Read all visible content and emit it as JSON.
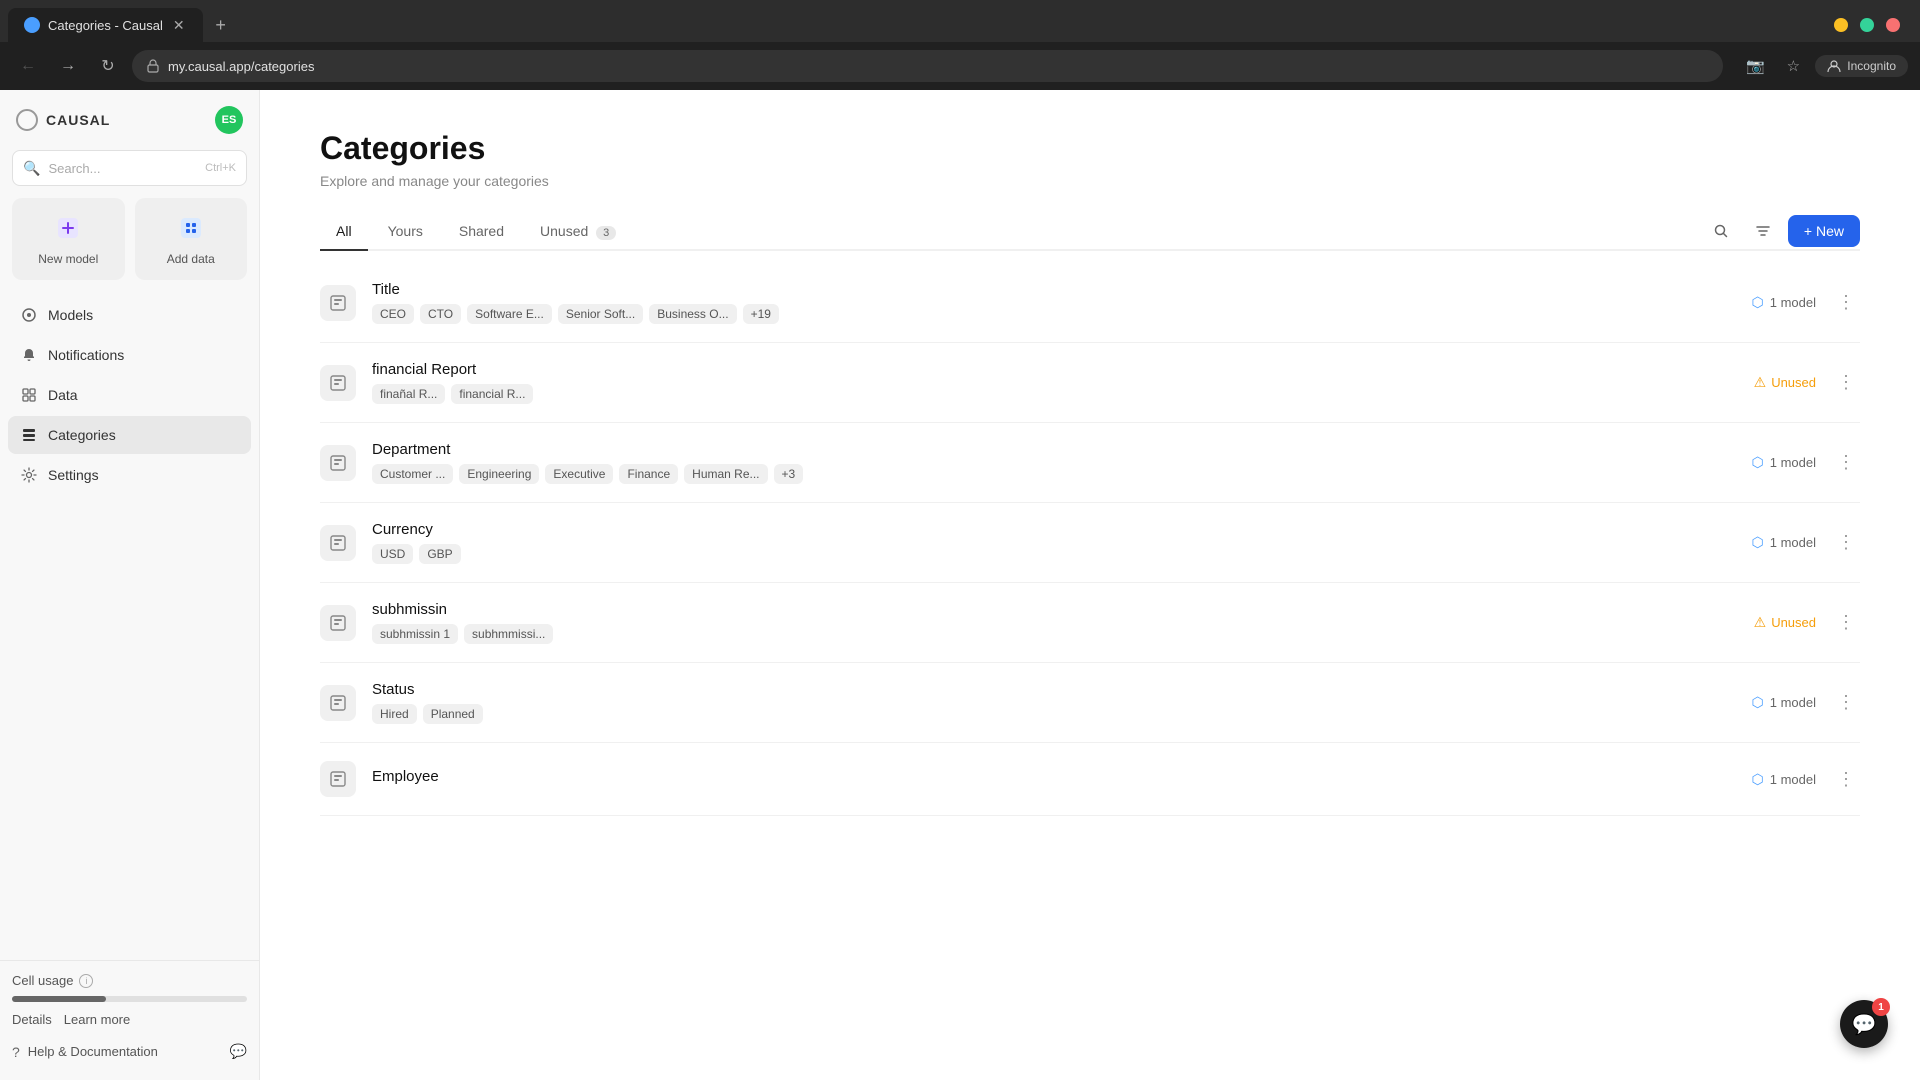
{
  "browser": {
    "tab_title": "Categories - Causal",
    "tab_favicon": "C",
    "url": "my.causal.app/categories",
    "incognito_label": "Incognito",
    "new_tab_icon": "+"
  },
  "sidebar": {
    "logo_text": "CAUSAL",
    "avatar_initials": "ES",
    "search_placeholder": "Search...",
    "search_shortcut": "Ctrl+K",
    "quick_actions": [
      {
        "label": "New model",
        "icon": "⬡"
      },
      {
        "label": "Add data",
        "icon": "⊞"
      }
    ],
    "nav_items": [
      {
        "label": "Models",
        "icon": "⊙"
      },
      {
        "label": "Notifications",
        "icon": "🔔"
      },
      {
        "label": "Data",
        "icon": "◫"
      },
      {
        "label": "Categories",
        "icon": "⊟",
        "active": true
      },
      {
        "label": "Settings",
        "icon": "⚙"
      }
    ],
    "cell_usage_label": "Cell usage",
    "details_link": "Details",
    "learn_more_link": "Learn more",
    "help_label": "Help & Documentation"
  },
  "page": {
    "title": "Categories",
    "subtitle": "Explore and manage your categories"
  },
  "tabs": [
    {
      "label": "All",
      "active": true
    },
    {
      "label": "Yours"
    },
    {
      "label": "Shared"
    },
    {
      "label": "Unused",
      "badge": "3"
    }
  ],
  "new_button_label": "+ New",
  "categories": [
    {
      "name": "Title",
      "tags": [
        "CEO",
        "CTO",
        "Software E...",
        "Senior Soft...",
        "Business O...",
        "+19"
      ],
      "meta_type": "model",
      "meta_label": "1 model"
    },
    {
      "name": "financial Report",
      "tags": [
        "finañal R...",
        "financial R..."
      ],
      "meta_type": "unused",
      "meta_label": "Unused"
    },
    {
      "name": "Department",
      "tags": [
        "Customer ...",
        "Engineering",
        "Executive",
        "Finance",
        "Human Re...",
        "+3"
      ],
      "meta_type": "model",
      "meta_label": "1 model"
    },
    {
      "name": "Currency",
      "tags": [
        "USD",
        "GBP"
      ],
      "meta_type": "model",
      "meta_label": "1 model"
    },
    {
      "name": "subhmissin",
      "tags": [
        "subhmissin 1",
        "subhmmissi..."
      ],
      "meta_type": "unused",
      "meta_label": "Unused"
    },
    {
      "name": "Status",
      "tags": [
        "Hired",
        "Planned"
      ],
      "meta_type": "model",
      "meta_label": "1 model"
    },
    {
      "name": "Employee",
      "tags": [],
      "meta_type": "model",
      "meta_label": "1 model"
    }
  ],
  "chat": {
    "badge": "1"
  }
}
